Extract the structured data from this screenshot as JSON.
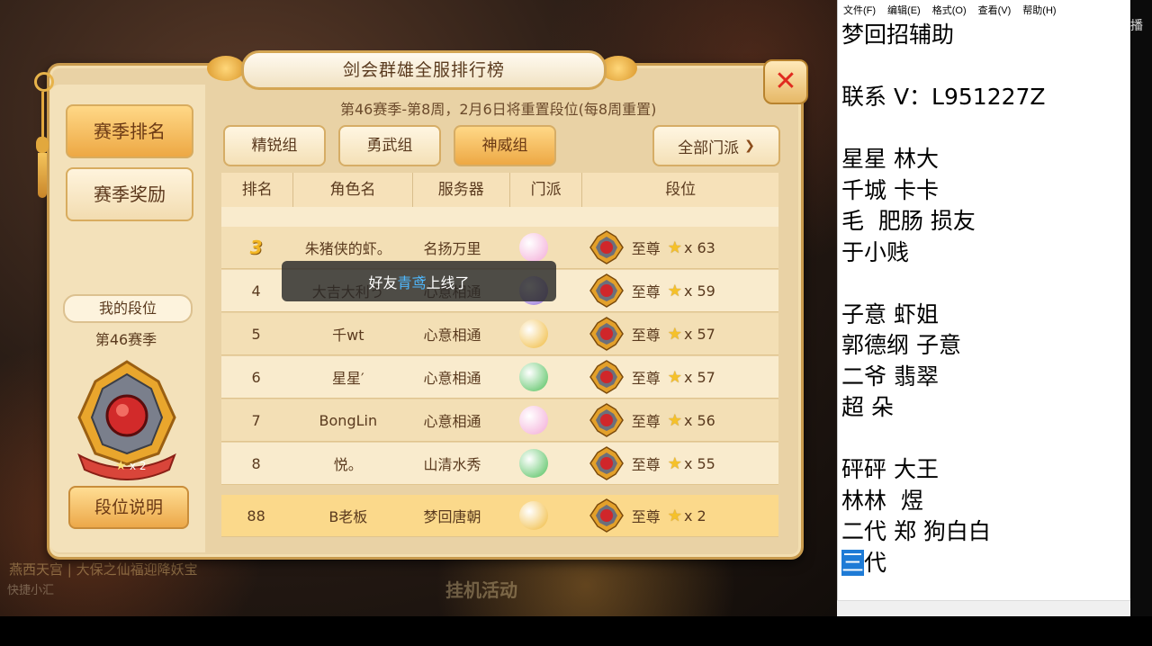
{
  "game": {
    "title": "剑会群雄全服排行榜",
    "season_info": "第46赛季-第8周，2月6日将重置段位(每8周重置)",
    "sidebar": {
      "tabs": [
        {
          "label": "赛季排名",
          "active": true
        },
        {
          "label": "赛季奖励",
          "active": false
        }
      ],
      "my_rank_label": "我的段位",
      "my_season": "第46赛季",
      "my_stars": "x 2",
      "rank_desc_button": "段位说明"
    },
    "groups": [
      {
        "label": "精锐组",
        "active": false
      },
      {
        "label": "勇武组",
        "active": false
      },
      {
        "label": "神威组",
        "active": true
      }
    ],
    "filter_label": "全部门派",
    "columns": [
      "排名",
      "角色名",
      "服务器",
      "门派",
      "段位"
    ],
    "rows": [
      {
        "rank": "3",
        "name": "朱猪侠的虾。",
        "server": "名扬万里",
        "sect": "pink",
        "tier": "至尊",
        "stars": "x 63"
      },
      {
        "rank": "4",
        "name": "大吉大利う",
        "server": "心意相通",
        "sect": "purple",
        "tier": "至尊",
        "stars": "x 59"
      },
      {
        "rank": "5",
        "name": "千wt",
        "server": "心意相通",
        "sect": "gold",
        "tier": "至尊",
        "stars": "x 57"
      },
      {
        "rank": "6",
        "name": "星星′",
        "server": "心意相通",
        "sect": "green",
        "tier": "至尊",
        "stars": "x 57"
      },
      {
        "rank": "7",
        "name": "BongLin",
        "server": "心意相通",
        "sect": "pink",
        "tier": "至尊",
        "stars": "x 56"
      },
      {
        "rank": "8",
        "name": "悦。",
        "server": "山清水秀",
        "sect": "green",
        "tier": "至尊",
        "stars": "x 55"
      }
    ],
    "my_row": {
      "rank": "88",
      "name": "B老板",
      "server": "梦回唐朝",
      "sect": "gold",
      "tier": "至尊",
      "stars": "x 2"
    },
    "toast": {
      "prefix": "好友",
      "friend": "青鸢",
      "suffix": "上线了"
    },
    "bg": {
      "chat1": "燕西天宫 | 大保之仙福迎降妖宝",
      "chat2": "快捷小汇",
      "btn": "挂机活动"
    },
    "colors": {
      "sect_pink": "#f3a9d6",
      "sect_purple": "#8e6ad6",
      "sect_gold": "#f0b93a",
      "sect_green": "#4fbf5a",
      "accent": "#eda844",
      "toast_highlight": "#4fb9ff"
    }
  },
  "notepad": {
    "menu": [
      "文件(F)",
      "编辑(E)",
      "格式(O)",
      "查看(V)",
      "帮助(H)"
    ],
    "lines": [
      "梦回招辅助",
      "",
      "联系 V：L951227Z",
      "",
      "星星 林大",
      "千城 卡卡",
      "毛  肥肠 损友",
      "于小贱",
      "",
      "子意 虾姐",
      "郭德纲 子意",
      "二爷 翡翠",
      "超 朵",
      "",
      "砰砰 大王",
      "林林  煜",
      "二代 郑 狗白白"
    ],
    "last_line_selected": "三",
    "last_line_rest": "代",
    "corner_mark": "播"
  }
}
